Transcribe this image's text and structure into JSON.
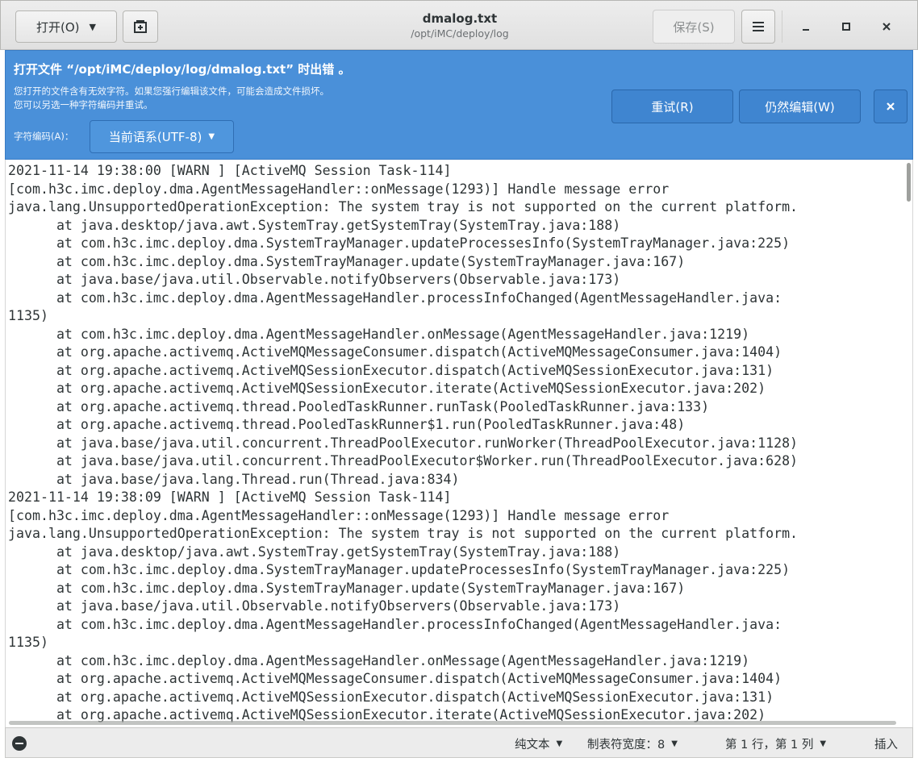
{
  "header": {
    "open_label": "打开(O)",
    "open_arrow": "▼",
    "new_tab_icon": "new-document-icon",
    "title": "dmalog.txt",
    "subtitle": "/opt/iMC/deploy/log",
    "save_label": "保存(S)",
    "menu_icon": "hamburger-menu-icon",
    "minimize_glyph": "–",
    "maximize_glyph": "◻",
    "close_glyph": "✕"
  },
  "infobar": {
    "title": "打开文件 “/opt/iMC/deploy/log/dmalog.txt” 时出错 。",
    "message_line1": "您打开的文件含有无效字符。如果您强行编辑该文件，可能会造成文件损坏。",
    "message_line2": "您可以另选一种字符编码并重试。",
    "encoding_label": "字符编码(A)：",
    "encoding_value": "当前语系(UTF-8)",
    "encoding_arrow": "▼",
    "retry_label": "重试(R)",
    "edit_anyway_label": "仍然编辑(W)",
    "close_glyph": "✕",
    "background_color": "#4a90d9"
  },
  "document": {
    "lines": [
      "2021-11-14 19:38:00 [WARN ] [ActiveMQ Session Task-114]",
      "[com.h3c.imc.deploy.dma.AgentMessageHandler::onMessage(1293)] Handle message error",
      "java.lang.UnsupportedOperationException: The system tray is not supported on the current platform.",
      "\tat java.desktop/java.awt.SystemTray.getSystemTray(SystemTray.java:188)",
      "\tat com.h3c.imc.deploy.dma.SystemTrayManager.updateProcessesInfo(SystemTrayManager.java:225)",
      "\tat com.h3c.imc.deploy.dma.SystemTrayManager.update(SystemTrayManager.java:167)",
      "\tat java.base/java.util.Observable.notifyObservers(Observable.java:173)",
      "\tat com.h3c.imc.deploy.dma.AgentMessageHandler.processInfoChanged(AgentMessageHandler.java:",
      "1135)",
      "\tat com.h3c.imc.deploy.dma.AgentMessageHandler.onMessage(AgentMessageHandler.java:1219)",
      "\tat org.apache.activemq.ActiveMQMessageConsumer.dispatch(ActiveMQMessageConsumer.java:1404)",
      "\tat org.apache.activemq.ActiveMQSessionExecutor.dispatch(ActiveMQSessionExecutor.java:131)",
      "\tat org.apache.activemq.ActiveMQSessionExecutor.iterate(ActiveMQSessionExecutor.java:202)",
      "\tat org.apache.activemq.thread.PooledTaskRunner.runTask(PooledTaskRunner.java:133)",
      "\tat org.apache.activemq.thread.PooledTaskRunner$1.run(PooledTaskRunner.java:48)",
      "\tat java.base/java.util.concurrent.ThreadPoolExecutor.runWorker(ThreadPoolExecutor.java:1128)",
      "\tat java.base/java.util.concurrent.ThreadPoolExecutor$Worker.run(ThreadPoolExecutor.java:628)",
      "\tat java.base/java.lang.Thread.run(Thread.java:834)",
      "2021-11-14 19:38:09 [WARN ] [ActiveMQ Session Task-114]",
      "[com.h3c.imc.deploy.dma.AgentMessageHandler::onMessage(1293)] Handle message error",
      "java.lang.UnsupportedOperationException: The system tray is not supported on the current platform.",
      "\tat java.desktop/java.awt.SystemTray.getSystemTray(SystemTray.java:188)",
      "\tat com.h3c.imc.deploy.dma.SystemTrayManager.updateProcessesInfo(SystemTrayManager.java:225)",
      "\tat com.h3c.imc.deploy.dma.SystemTrayManager.update(SystemTrayManager.java:167)",
      "\tat java.base/java.util.Observable.notifyObservers(Observable.java:173)",
      "\tat com.h3c.imc.deploy.dma.AgentMessageHandler.processInfoChanged(AgentMessageHandler.java:",
      "1135)",
      "\tat com.h3c.imc.deploy.dma.AgentMessageHandler.onMessage(AgentMessageHandler.java:1219)",
      "\tat org.apache.activemq.ActiveMQMessageConsumer.dispatch(ActiveMQMessageConsumer.java:1404)",
      "\tat org.apache.activemq.ActiveMQSessionExecutor.dispatch(ActiveMQSessionExecutor.java:131)",
      "\tat org.apache.activemq.ActiveMQSessionExecutor.iterate(ActiveMQSessionExecutor.java:202)"
    ]
  },
  "statusbar": {
    "status_icon": "minus-circle-icon",
    "language_label": "纯文本",
    "tab_width_label": "制表符宽度：8",
    "position_label": "第 1 行，第 1 列",
    "insert_mode_label": "插入",
    "arrow": "▼"
  }
}
